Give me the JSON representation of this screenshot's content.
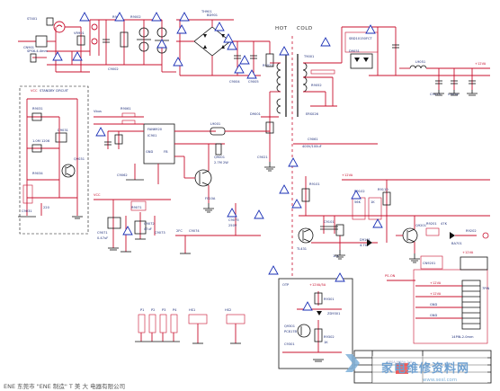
{
  "labels": {
    "hot": "HOT",
    "cold": "COLD",
    "otp": "OTP",
    "footer": "ENE 东莞市 \"ENE 制造\" T 美 大 电器有限公司"
  },
  "blocks": {
    "pfc_ic": "FAN6920",
    "standby_ic": "FSP4435",
    "feedback": "PC817B"
  },
  "watermark": {
    "site": "家电维修资料网",
    "url": "www.sesl.com"
  },
  "colors": {
    "wire": "#c8102e",
    "ground": "#111111",
    "warning": "#1a2fb5",
    "label": "#1f2f7a"
  }
}
